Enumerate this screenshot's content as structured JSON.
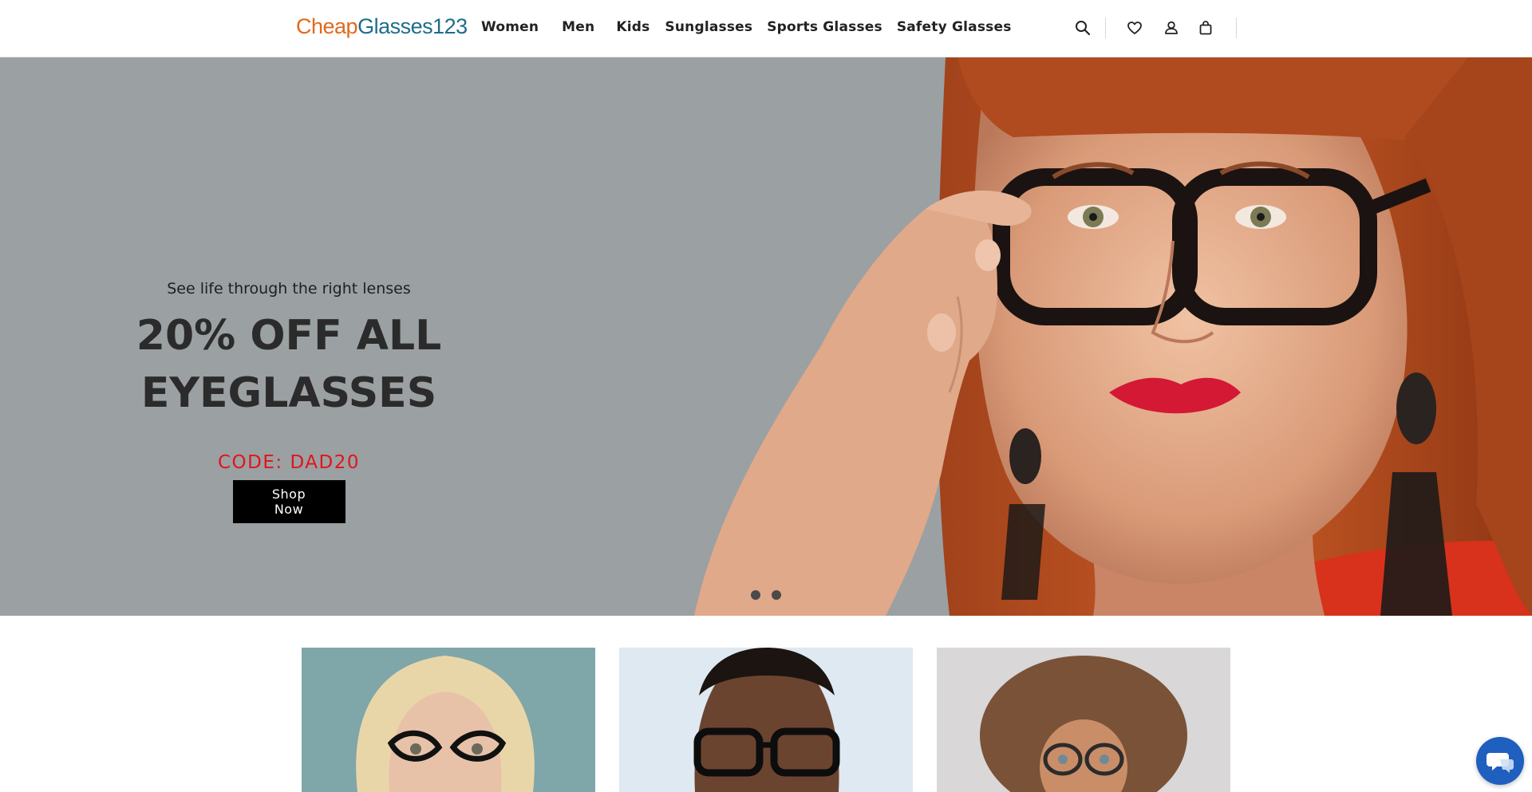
{
  "header": {
    "logo": {
      "part1": "Cheap",
      "part2": "Glasses123"
    },
    "nav": [
      {
        "label": "Women"
      },
      {
        "label": "Men"
      },
      {
        "label": "Kids"
      },
      {
        "label": "Sunglasses"
      },
      {
        "label": "Sports Glasses"
      },
      {
        "label": "Safety Glasses"
      }
    ],
    "icons": [
      "search-icon",
      "heart-icon",
      "user-icon",
      "bag-icon"
    ]
  },
  "hero": {
    "tagline": "See life through the right lenses",
    "headline_line1": "20% OFF ALL",
    "headline_line2": "EYEGLASSES",
    "code": "CODE: DAD20",
    "button": "Shop Now",
    "slides": 2,
    "active_slide": 1
  },
  "categories": [
    {
      "name": "women-category"
    },
    {
      "name": "men-category"
    },
    {
      "name": "kids-category"
    }
  ],
  "colors": {
    "logo_orange": "#e06a1b",
    "logo_blue": "#1d6d8a",
    "code_red": "#e0151a",
    "hero_bg": "#9ba0a3",
    "chat_blue": "#1e5fbf"
  }
}
